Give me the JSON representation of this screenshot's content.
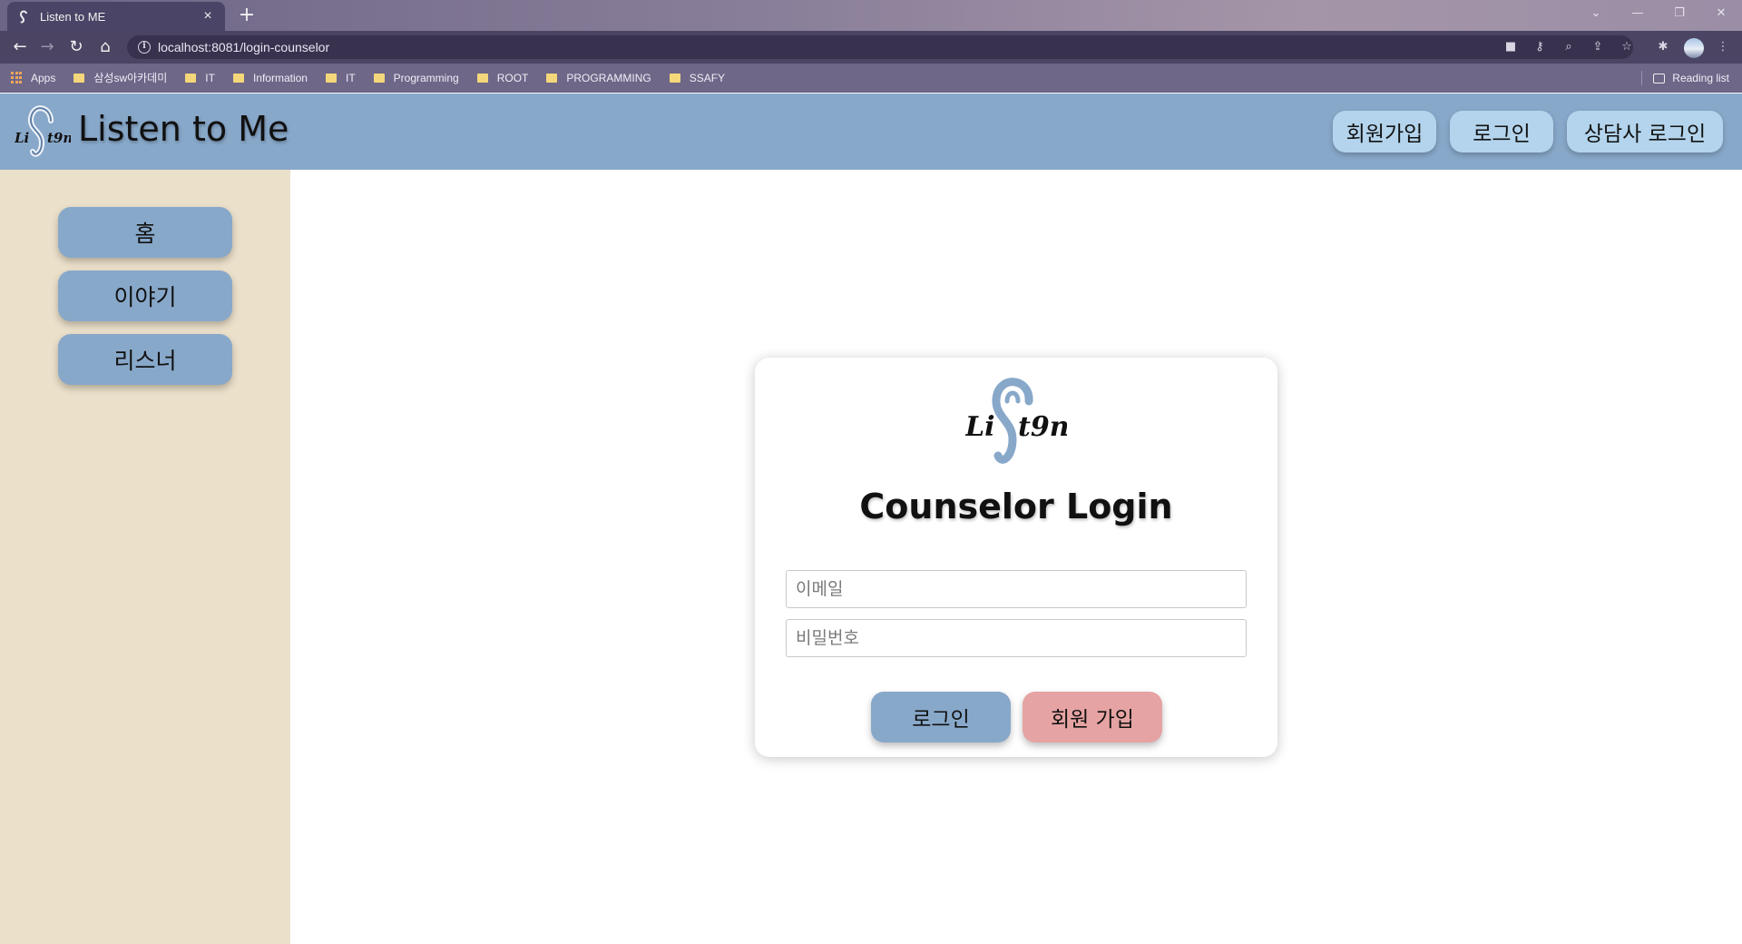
{
  "browser": {
    "tab_title": "Listen to ME",
    "tab_close": "×",
    "new_tab": "+",
    "url": "localhost:8081/login-counselor",
    "bookmarks": [
      "Apps",
      "삼성sw아카데미",
      "IT",
      "Information",
      "IT",
      "Programming",
      "ROOT",
      "PROGRAMMING",
      "SSAFY"
    ],
    "reading_list": "Reading list"
  },
  "header": {
    "brand": "Listen to Me",
    "buttons": {
      "signup": "회원가입",
      "login": "로그인",
      "counselor_login": "상담사 로그인"
    }
  },
  "sidebar": {
    "items": [
      "홈",
      "이야기",
      "리스너"
    ]
  },
  "login_card": {
    "title": "Counselor Login",
    "email_placeholder": "이메일",
    "password_placeholder": "비밀번호",
    "login_button": "로그인",
    "signup_button": "회원 가입"
  },
  "colors": {
    "header_bg": "#88a8ca",
    "sidebar_bg": "#ebe0ca",
    "header_button": "#b3d4ec",
    "primary_button": "#88a8ca",
    "signup_button": "#e6a3a3",
    "logo_ear": "#88a8ca"
  }
}
